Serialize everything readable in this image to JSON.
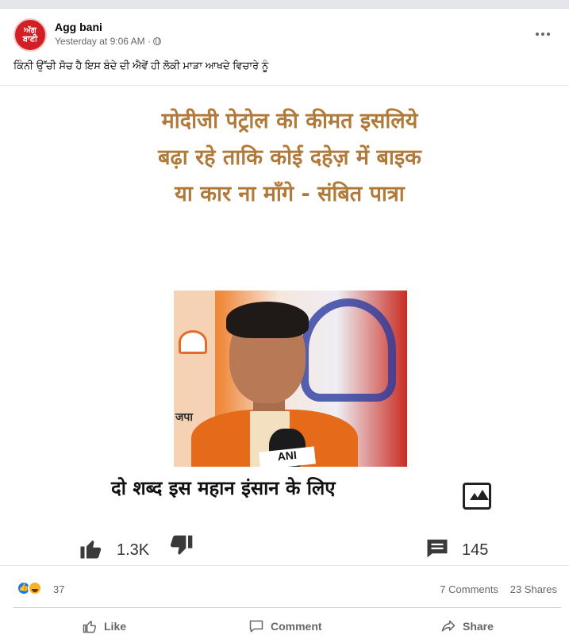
{
  "post": {
    "author": "Agg bani",
    "avatar_text_line1": "ਅੱਗ",
    "avatar_text_line2": "ਬਾਣੀ",
    "timestamp": "Yesterday at 9:06 AM · ",
    "caption": "ਕਿੰਨੀ ਉੱਚੀ ਸੋਚ ਹੈ ਇਸ ਬੰਦੇ ਦੀ ਐਵੇਂ ਹੀ ਲੋਕੀ ਮਾੜਾ ਆਖਦੇ ਵਿਚਾਰੇ ਨੂੰ"
  },
  "meme": {
    "headline": [
      "मोदीजी पेट्रोल की कीमत इसलिये",
      "बढ़ा रहे ताकि कोई दहेज़ में बाइक",
      "या कार ना माँगे - संबित पात्रा"
    ],
    "party_text": "जपा",
    "mic_label": "ANI",
    "subline": "दो शब्द इस महान इंसान के लिए",
    "like_count": "1.3K",
    "comment_count": "145"
  },
  "reactions": {
    "count": "37",
    "comments": "7 Comments",
    "shares": "23 Shares"
  },
  "actions": {
    "like": "Like",
    "comment": "Comment",
    "share": "Share"
  },
  "colors": {
    "accent": "#1877f2",
    "headline": "#b07a3a",
    "muted": "#65676b"
  }
}
